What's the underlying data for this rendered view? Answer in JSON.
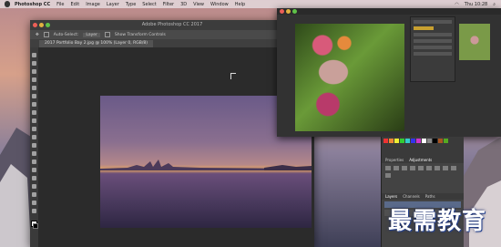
{
  "menubar": {
    "app": "Photoshop CC",
    "items": [
      "File",
      "Edit",
      "Image",
      "Layer",
      "Type",
      "Select",
      "Filter",
      "3D",
      "View",
      "Window",
      "Help"
    ],
    "clock": "Thu 10:28"
  },
  "main_window": {
    "title": "Adobe Photoshop CC 2017",
    "options": {
      "auto_select_label": "Auto-Select:",
      "auto_select_value": "Layer",
      "show_transform": "Show Transform Controls"
    },
    "doc_tab": "2017 Portfolio Bay 2.jpg @ 100% (Layer 0, RGB/8)"
  },
  "panels": {
    "tabs": [
      "Properties",
      "Adjustments"
    ],
    "layer_tabs": [
      "Layers",
      "Channels",
      "Paths"
    ]
  },
  "watermark": "最需教育",
  "colors": {
    "accent": "#5a6a8a"
  }
}
